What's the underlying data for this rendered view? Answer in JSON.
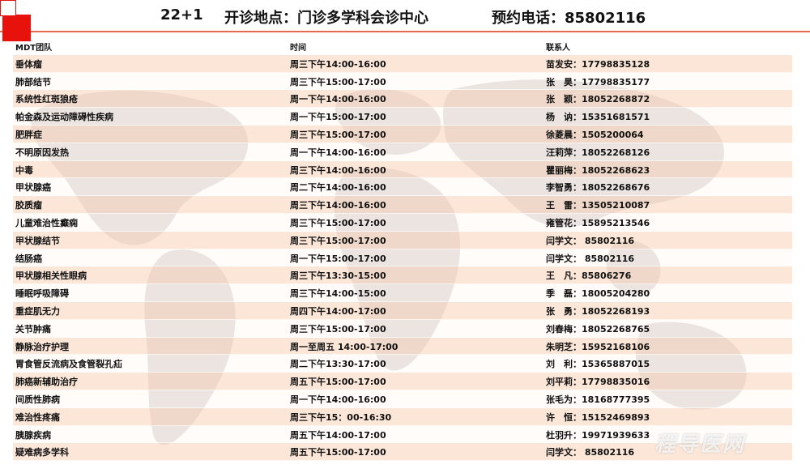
{
  "header": {
    "number": "22+1",
    "location": "开诊地点：门诊多学科会诊中心",
    "phone": "预约电话：85802116"
  },
  "table": {
    "columns": [
      "MDT团队",
      "时间",
      "联系人"
    ],
    "rows": [
      [
        "垂体瘤",
        "周三下午14:00-16:00",
        "苗发安：17798835128"
      ],
      [
        "肺部结节",
        "周三下午15:00-17:00",
        "张　昊：17798835177"
      ],
      [
        "系统性红斑狼疮",
        "周一下午14:00-16:00",
        "张　颖：18052268872"
      ],
      [
        "帕金森及运动障碍性疾病",
        "周一下午15:00-17:00",
        "杨　讷：15351681571"
      ],
      [
        "肥胖症",
        "周三下午15:00-17:00",
        "徐菱晨：1505200064"
      ],
      [
        "不明原因发热",
        "周一下午14:00-16:00",
        "汪莉萍：18052268126"
      ],
      [
        "中毒",
        "周三下午14:00-16:00",
        "瞿丽梅：18052268623"
      ],
      [
        "甲状腺癌",
        "周二下午14:00-16:00",
        "李智勇：18052268676"
      ],
      [
        "胶质瘤",
        "周三下午14:00-16:00",
        "王　雷：13505210087"
      ],
      [
        "儿童难治性癫痫",
        "周三下午15:00-17:00",
        "雍管花：15895213546"
      ],
      [
        "甲状腺结节",
        "周三下午15:00-17:00",
        "闫学文： 85802116"
      ],
      [
        "结肠癌",
        "周一下午15:00-17:00",
        "闫学文： 85802116"
      ],
      [
        "甲状腺相关性眼病",
        "周三下午13:30-15:00",
        "王　凡：85806276"
      ],
      [
        "睡眠呼吸障碍",
        "周三下午14:00-15:00",
        "季　磊：18005204280"
      ],
      [
        "重症肌无力",
        "周四下午14:00-17:00",
        "张　勇：18052268193"
      ],
      [
        "关节肿痛",
        "周三下午15:00-17:00",
        "刘春梅：18052268765"
      ],
      [
        "静脉治疗护理",
        "周一至周五 14:00-17:00",
        "朱明芝：15952168106"
      ],
      [
        "胃食管反流病及食管裂孔疝",
        "周二下午13:30-17:00",
        "刘　利：15365887015"
      ],
      [
        "肺癌新辅助治疗",
        "周五下午15:00-17:00",
        "刘平莉：17798835016"
      ],
      [
        "间质性肺病",
        "周一下午14:00-16:00",
        "张毛为：18168777395"
      ],
      [
        "难治性疼痛",
        "周三下午15：00-16:30",
        "许　恒：15152469893"
      ],
      [
        "胰腺疾病",
        "周五下午14:00-17:00",
        "杜羽升：19971939633"
      ],
      [
        "疑难病多学科",
        "周五下午15:00-17:00",
        "闫学文： 85802116"
      ]
    ]
  },
  "watermark": "程导医网",
  "colors": {
    "accent": "#e8120c",
    "row_band": "#f8d6c0",
    "map": "#d4ccc8"
  }
}
